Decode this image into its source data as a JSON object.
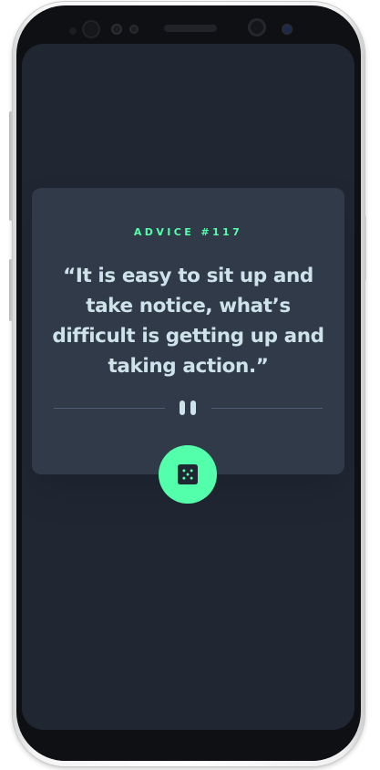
{
  "advice": {
    "label": "ADVICE #117",
    "quote": "“It is easy to sit up and take notice, what’s difficult is getting up and taking action.”"
  },
  "controls": {
    "dice_icon": "dice-icon",
    "pause_icon": "pause-icon"
  },
  "colors": {
    "accent": "#53ffaa",
    "background": "#202733",
    "card": "#313a48",
    "text": "#cee3e9",
    "divider": "#4f5d74"
  }
}
